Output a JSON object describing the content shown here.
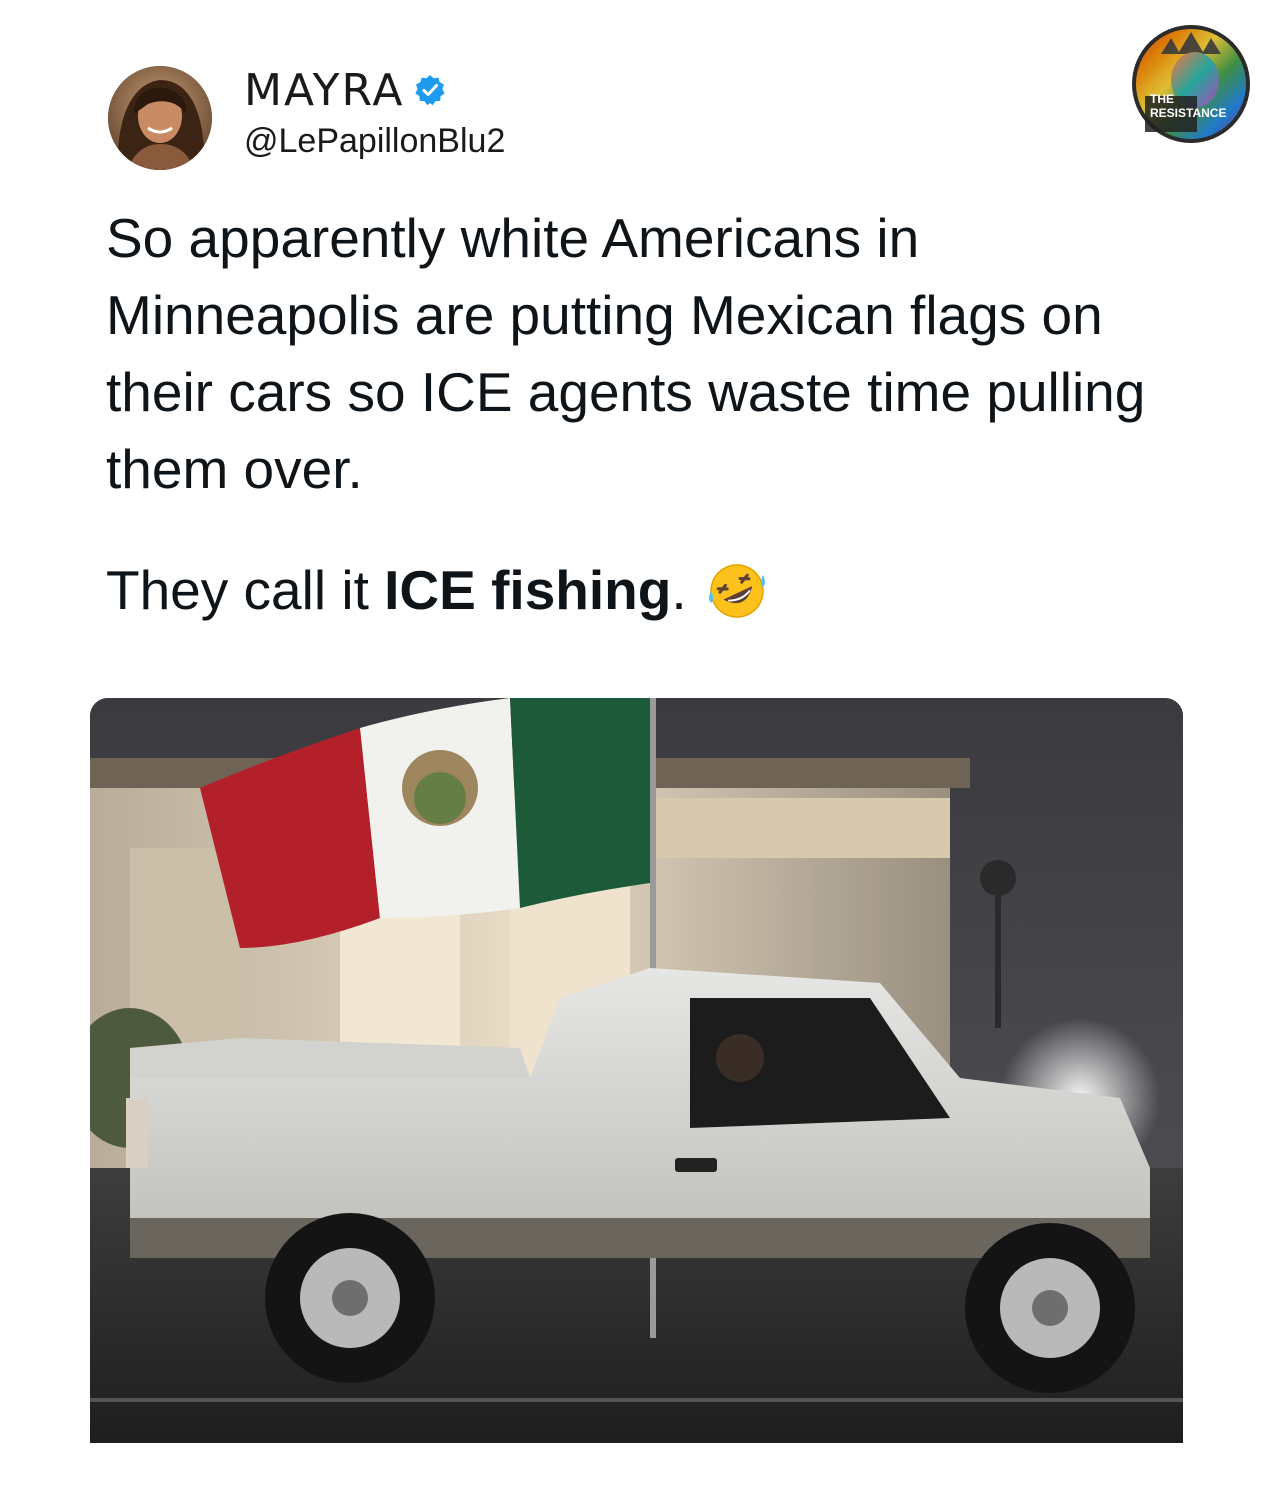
{
  "author": {
    "display_name": "MAYRA",
    "handle": "@LePapillonBlu2",
    "verified": true,
    "avatar_icon": "profile-photo"
  },
  "badge": {
    "line1": "THE",
    "line2": "RESISTANCE",
    "icon": "statue-of-liberty-rainbow-badge"
  },
  "tweet": {
    "text": "So apparently white Americans in Minneapolis are putting Mexican flags on their cars so ICE agents waste time pulling them over.",
    "tagline_prefix": "They call it ",
    "tagline_bold": "ICE fishing",
    "tagline_suffix": ".",
    "emoji": "rolling-on-floor-laughing-emoji"
  },
  "media": {
    "description_icon": "photo-white-pickup-truck-mexican-flag"
  },
  "colors": {
    "verified_blue": "#1d9bf0",
    "text": "#0f1419",
    "flag_green": "#1d5a3a",
    "flag_red": "#b3202a"
  }
}
